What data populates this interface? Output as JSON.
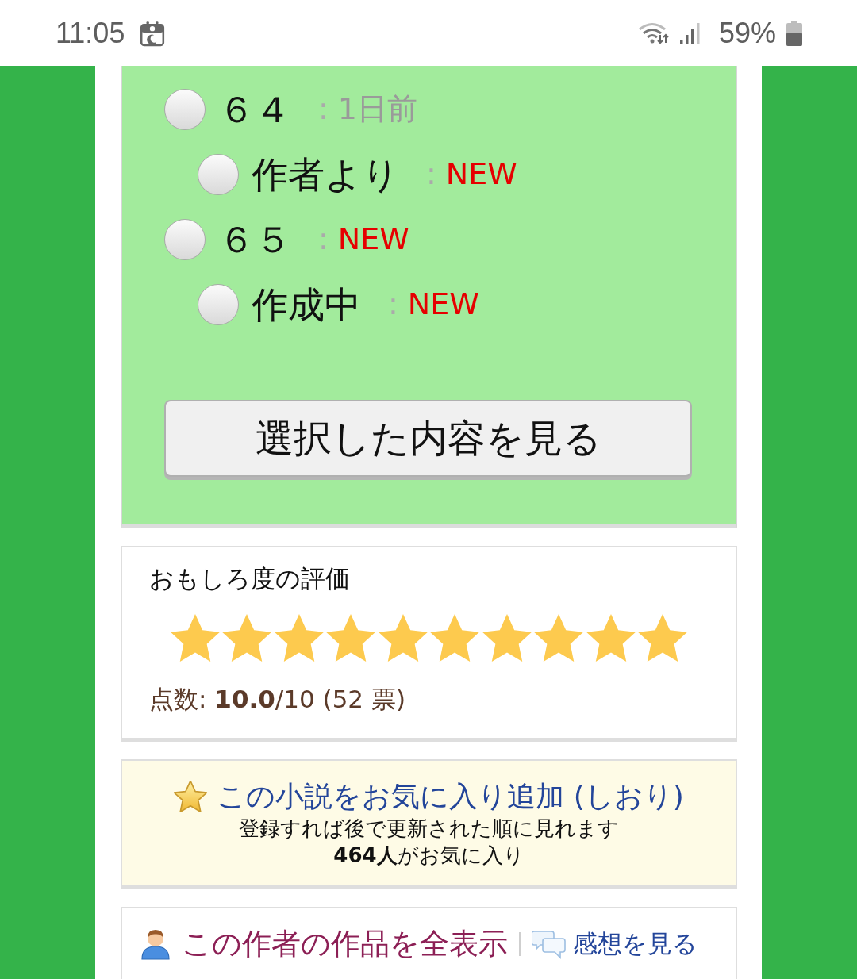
{
  "status_bar": {
    "time": "11:05",
    "battery": "59%"
  },
  "chapter_list": {
    "items": [
      {
        "label": "６４",
        "separator": ":",
        "status": "1日前",
        "new": false,
        "selected": false,
        "children": [
          {
            "label": "作者より",
            "separator": ":",
            "status": "NEW",
            "new": true,
            "selected": false
          }
        ]
      },
      {
        "label": "６５",
        "separator": ":",
        "status": "NEW",
        "new": true,
        "selected": false,
        "children": [
          {
            "label": "作成中",
            "separator": ":",
            "status": "NEW",
            "new": true,
            "selected": false
          }
        ]
      }
    ],
    "button": "選択した内容を見る"
  },
  "rating": {
    "title": "おもしろ度の評価",
    "stars": 10,
    "score": "点数: **10.0**/10 (52 票)"
  },
  "favorite": {
    "link": "この小説をお気に入り追加 (しおり)",
    "note": "登録すれば後で更新された順に見れます",
    "count": "**464人**がお気に入り"
  },
  "author_links": {
    "works_link": "この作者の作品を全表示",
    "reviews_link": "感想を見る"
  }
}
